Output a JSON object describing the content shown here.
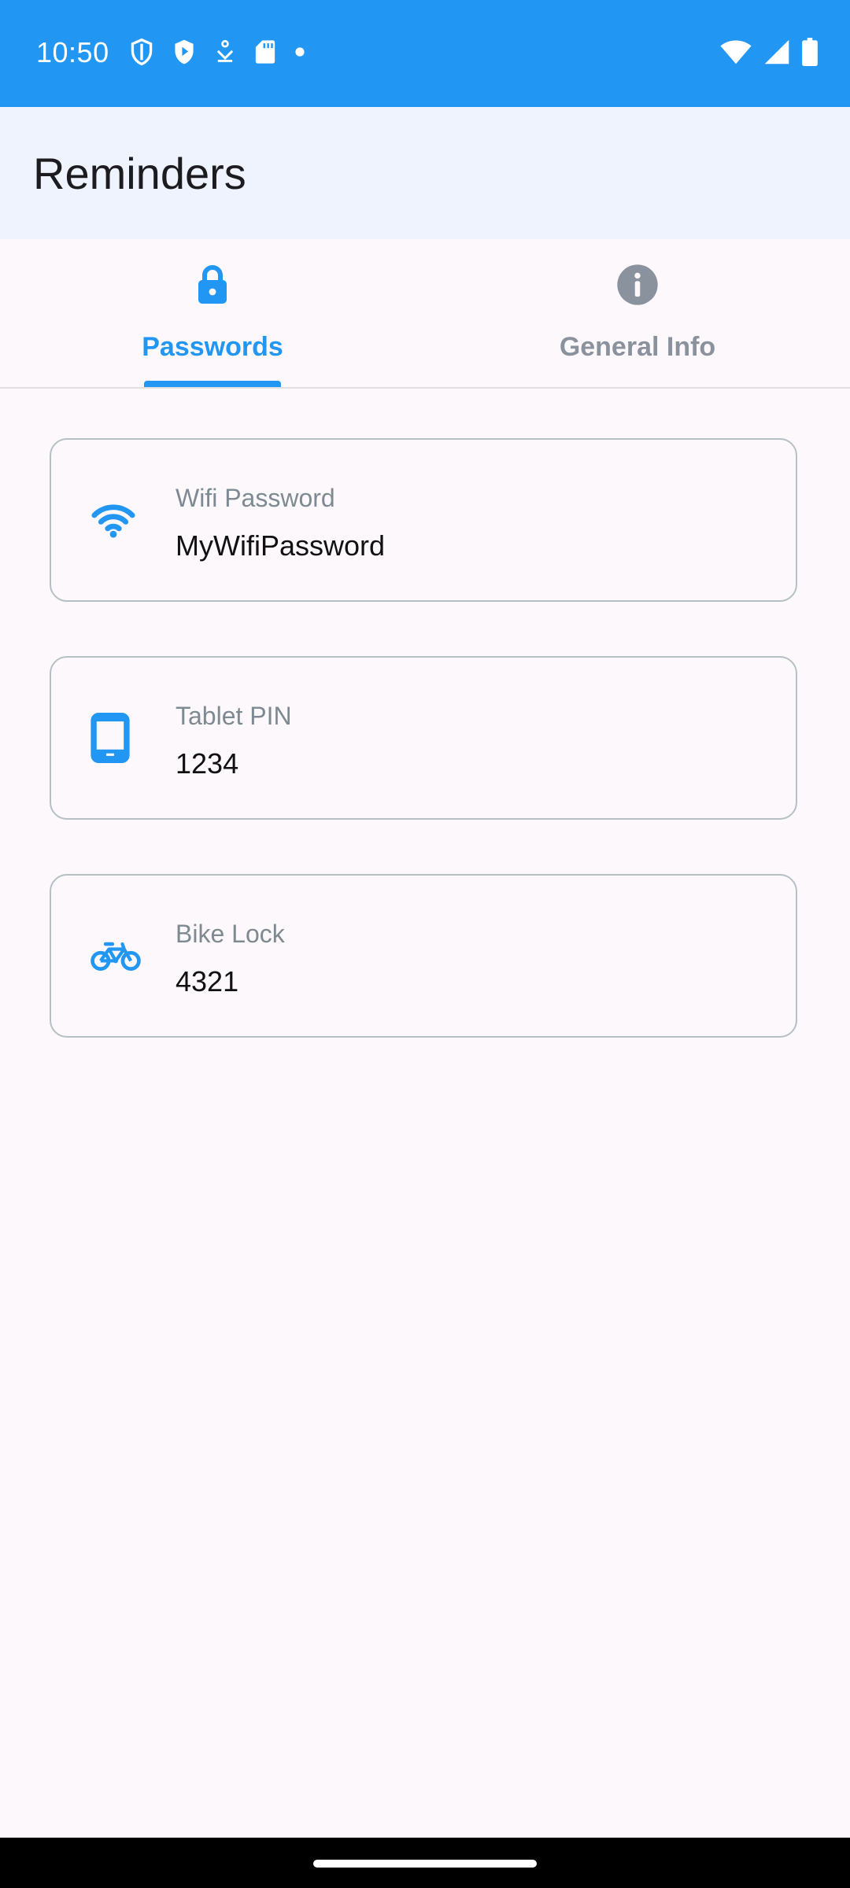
{
  "status_bar": {
    "time": "10:50",
    "left_icons": [
      "shield-outline-icon",
      "shield-play-icon",
      "download-icon",
      "sd-card-icon",
      "dot-icon"
    ],
    "right_icons": [
      "wifi-icon",
      "cellular-signal-icon",
      "battery-icon"
    ]
  },
  "app_bar": {
    "title": "Reminders"
  },
  "tabs": [
    {
      "label": "Passwords",
      "icon": "lock-icon",
      "active": true
    },
    {
      "label": "General Info",
      "icon": "info-icon",
      "active": false
    }
  ],
  "cards": [
    {
      "icon": "wifi-icon",
      "label": "Wifi Password",
      "value": "MyWifiPassword"
    },
    {
      "icon": "tablet-icon",
      "label": "Tablet PIN",
      "value": "1234"
    },
    {
      "icon": "bicycle-icon",
      "label": "Bike Lock",
      "value": "4321"
    }
  ],
  "colors": {
    "accent": "#2196F3",
    "inactive_tab": "#8A929D",
    "background": "#FDF8FC",
    "app_bar": "#EEF3FD"
  }
}
